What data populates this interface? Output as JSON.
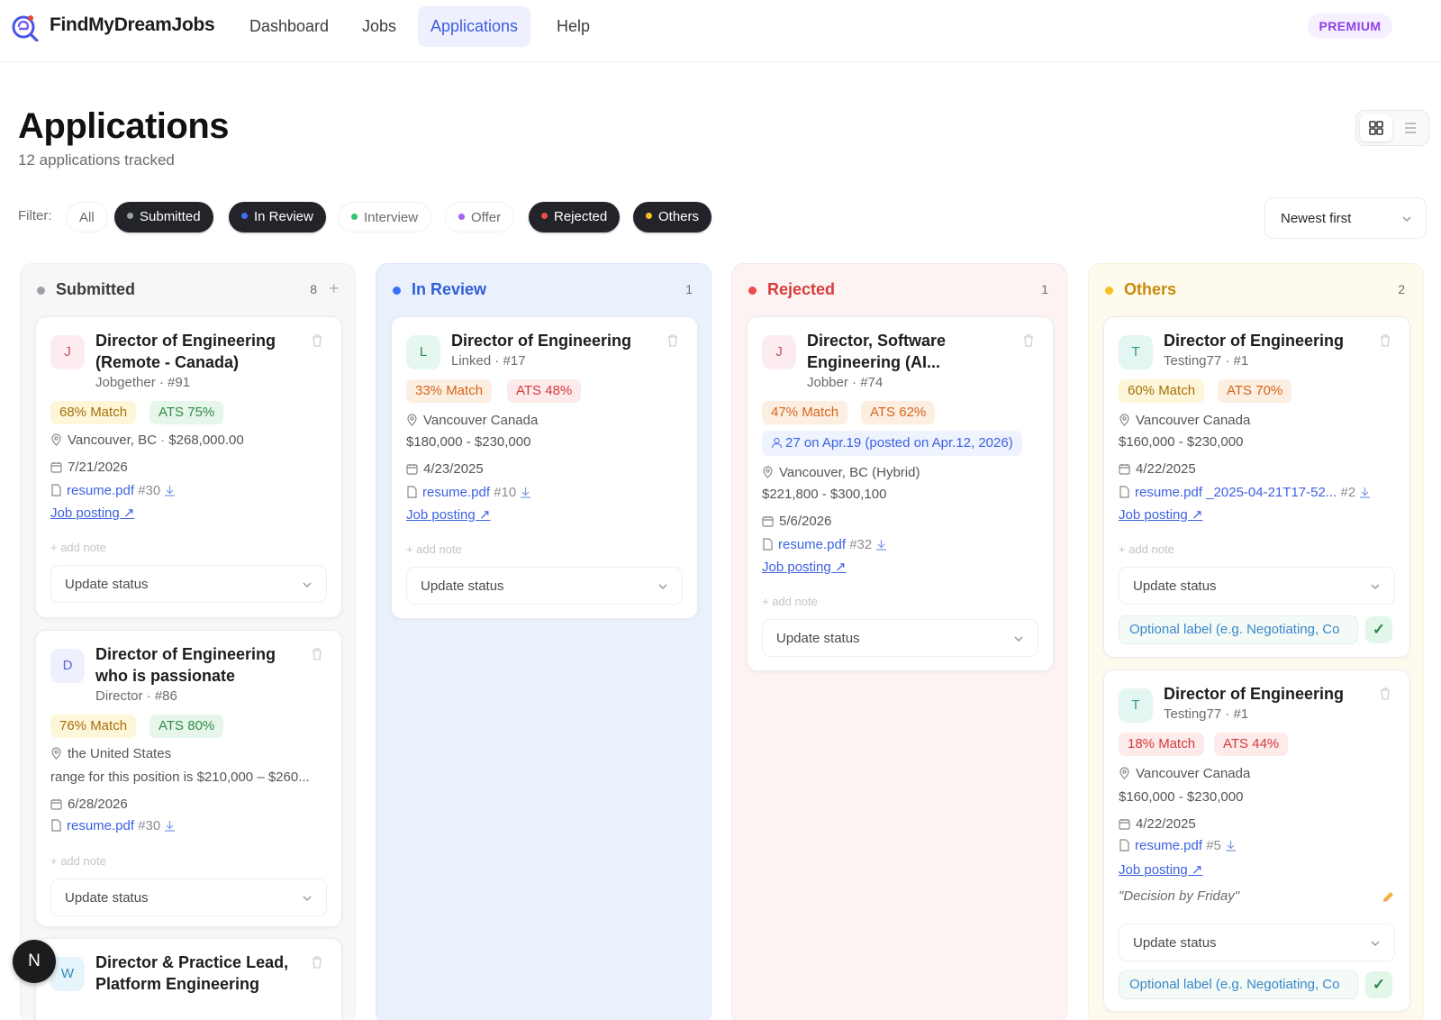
{
  "app": {
    "brand": "FindMyDreamJobs",
    "premium": "PREMIUM"
  },
  "nav": [
    {
      "label": "Dashboard"
    },
    {
      "label": "Jobs"
    },
    {
      "label": "Applications",
      "active": true
    },
    {
      "label": "Help"
    }
  ],
  "page": {
    "title": "Applications",
    "subtitle": "12 applications tracked"
  },
  "filters": {
    "label": "Filter:",
    "chips": [
      {
        "label": "All",
        "active": false
      },
      {
        "label": "Submitted",
        "active": true,
        "color": "#9aa0a6"
      },
      {
        "label": "In Review",
        "active": true,
        "color": "#3b6ff5"
      },
      {
        "label": "Interview",
        "active": false,
        "color": "#34c36b"
      },
      {
        "label": "Offer",
        "active": false,
        "color": "#a461f2"
      },
      {
        "label": "Rejected",
        "active": true,
        "color": "#ee4b4b"
      },
      {
        "label": "Others",
        "active": true,
        "color": "#f4c021"
      }
    ],
    "sort": "Newest first"
  },
  "colors": {
    "accent": "#3d5be0",
    "submitted": "#9aa0a6",
    "in_review": "#3b6ff5",
    "rejected": "#ee4b4b",
    "others": "#f4c021"
  },
  "common": {
    "add_note": "+ add note",
    "update_status": "Update status",
    "job_posting": "Job posting ↗",
    "label_placeholder": "Optional label (e.g. Negotiating, Co"
  },
  "columns": [
    {
      "title": "Submitted",
      "count": "8",
      "cards": [
        {
          "avatar": "J",
          "title": "Director of Engineering (Remote - Canada)",
          "meta": "Jobgether · #91",
          "match": "68% Match",
          "ats": "ATS 75%",
          "location": "Vancouver, BC",
          "salary": "$268,000.00",
          "date": "7/21/2026",
          "resume": "resume.pdf",
          "resume_id": "#30"
        },
        {
          "avatar": "D",
          "title": "Director of Engineering who is passionate",
          "meta": "Director · #86",
          "match": "76% Match",
          "ats": "ATS 80%",
          "location": "the United States",
          "salary": "range for this position is $210,000 – $260...",
          "date": "6/28/2026",
          "resume": "resume.pdf",
          "resume_id": "#30"
        },
        {
          "avatar": "W",
          "title": "Director & Practice Lead, Platform Engineering"
        }
      ]
    },
    {
      "title": "In Review",
      "count": "1",
      "cards": [
        {
          "avatar": "L",
          "title": "Director of Engineering",
          "meta": "Linked · #17",
          "match": "33% Match",
          "ats": "ATS 48%",
          "location": "Vancouver Canada",
          "salary": "$180,000 - $230,000",
          "date": "4/23/2025",
          "resume": "resume.pdf",
          "resume_id": "#10"
        }
      ]
    },
    {
      "title": "Rejected",
      "count": "1",
      "cards": [
        {
          "avatar": "J",
          "title": "Director, Software Engineering (AI...",
          "meta": "Jobber · #74",
          "match": "47% Match",
          "ats": "ATS 62%",
          "referral": "27 on Apr.19 (posted on Apr.12, 2026)",
          "location": "Vancouver, BC (Hybrid)",
          "salary": "$221,800 - $300,100",
          "date": "5/6/2026",
          "resume": "resume.pdf",
          "resume_id": "#32"
        }
      ]
    },
    {
      "title": "Others",
      "count": "2",
      "cards": [
        {
          "avatar": "T",
          "title": "Director of Engineering",
          "meta": "Testing77 · #1",
          "match": "60% Match",
          "ats": "ATS 70%",
          "location": "Vancouver Canada",
          "salary": "$160,000 - $230,000",
          "date": "4/22/2025",
          "resume": "resume.pdf _2025-04-21T17-52...",
          "resume_id": "#2"
        },
        {
          "avatar": "T",
          "title": "Director of Engineering",
          "meta": "Testing77 · #1",
          "match": "18% Match",
          "ats": "ATS 44%",
          "location": "Vancouver Canada",
          "salary": "$160,000 - $230,000",
          "date": "4/22/2025",
          "resume": "resume.pdf",
          "resume_id": "#5",
          "note": "\"Decision by Friday\""
        }
      ]
    }
  ],
  "user": {
    "initial": "N"
  }
}
